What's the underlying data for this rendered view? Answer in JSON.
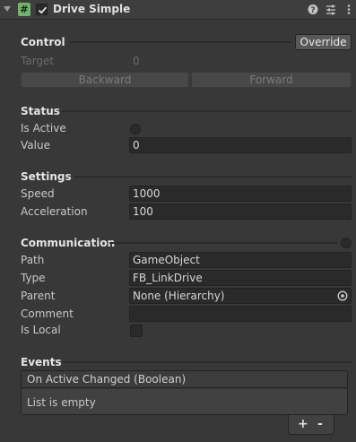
{
  "component": {
    "title": "Drive Simple",
    "enabled": true,
    "script_icon_glyph": "#"
  },
  "control": {
    "title": "Control",
    "override_label": "Override",
    "target_label": "Target",
    "target_value": "0",
    "backward_label": "Backward",
    "forward_label": "Forward"
  },
  "status": {
    "title": "Status",
    "is_active_label": "Is Active",
    "value_label": "Value",
    "value": "0"
  },
  "settings": {
    "title": "Settings",
    "speed_label": "Speed",
    "speed_value": "1000",
    "acceleration_label": "Acceleration",
    "acceleration_value": "100"
  },
  "communication": {
    "title": "Communication",
    "path_label": "Path",
    "path_value": "GameObject",
    "type_label": "Type",
    "type_value": "FB_LinkDrive",
    "parent_label": "Parent",
    "parent_value": "None (Hierarchy)",
    "comment_label": "Comment",
    "comment_value": "",
    "is_local_label": "Is Local",
    "is_local_checked": false
  },
  "events": {
    "title": "Events",
    "list_header": "On Active Changed (Boolean)",
    "empty_text": "List is empty",
    "add_label": "+",
    "remove_label": "-"
  },
  "colors": {
    "background": "#383838",
    "field": "#2a2a2a",
    "script_icon": "#6fb56a"
  }
}
